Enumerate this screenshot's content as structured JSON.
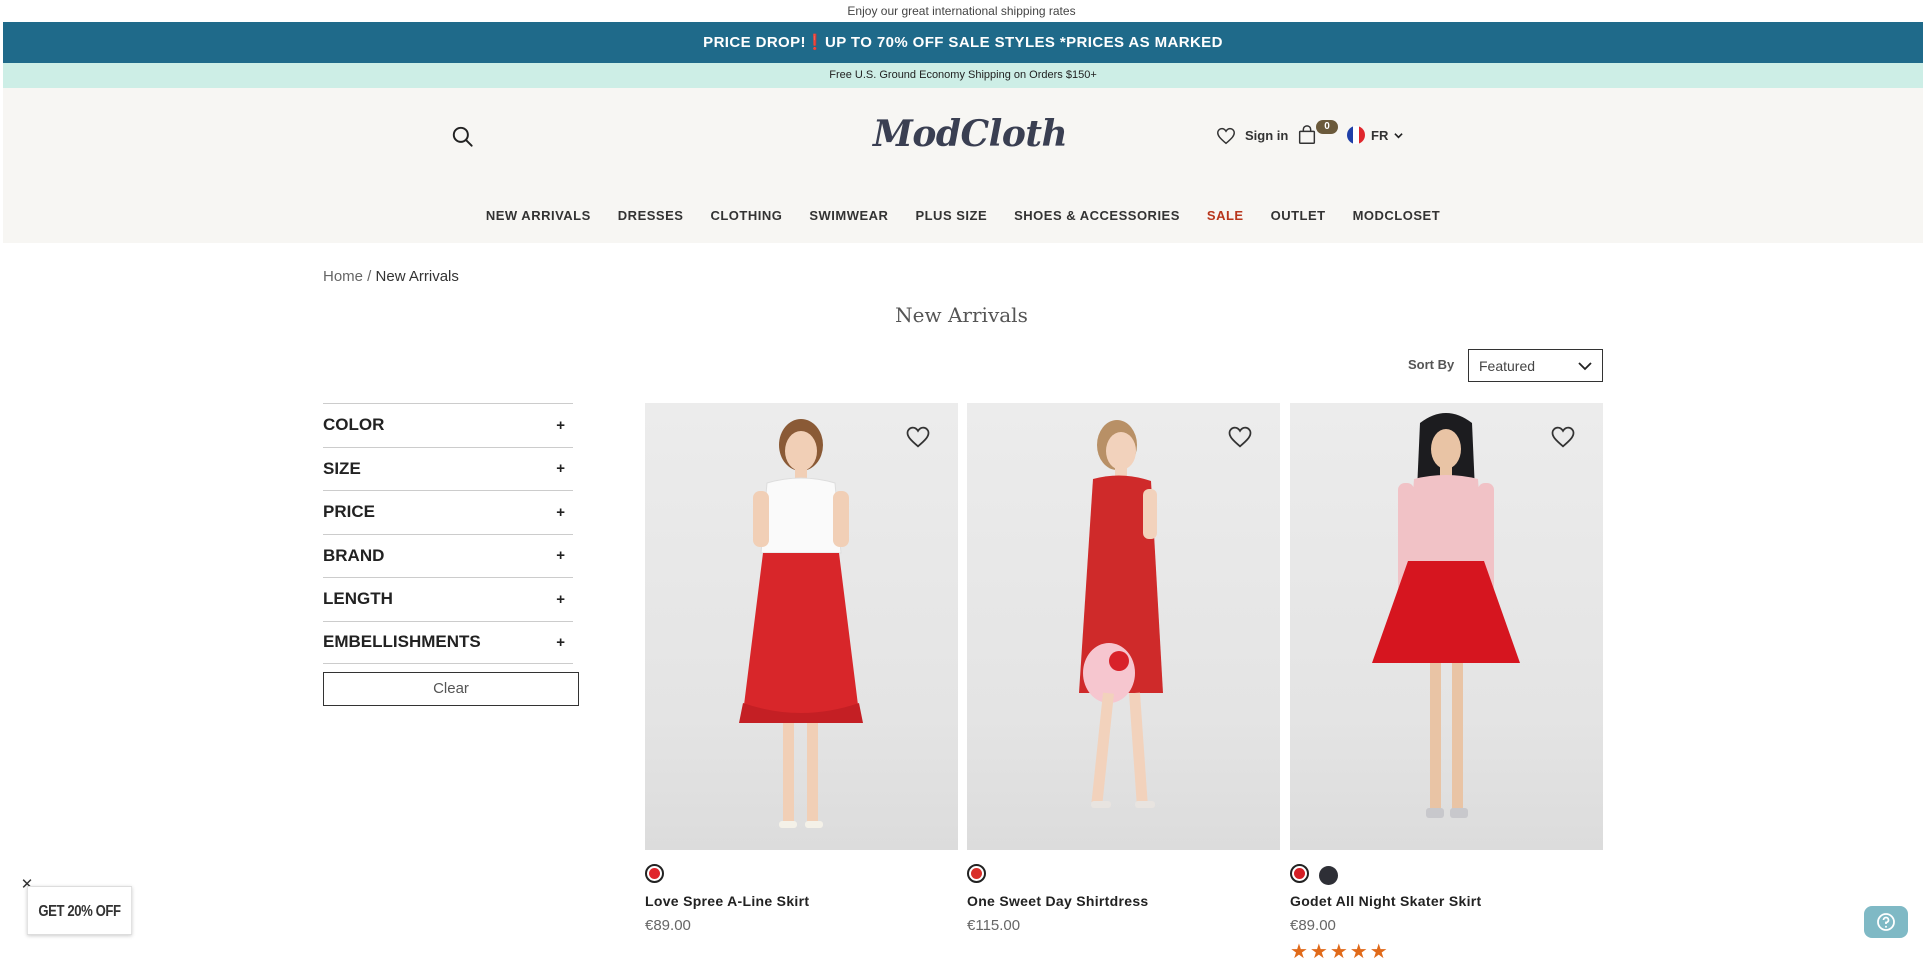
{
  "topbar": {
    "text": "Enjoy our great international shipping rates"
  },
  "promo": {
    "left": "PRICE DROP!",
    "bang": "❗",
    "right": "UP TO 70% OFF SALE STYLES *PRICES AS MARKED"
  },
  "shipping": {
    "text": "Free U.S. Ground Economy Shipping on Orders $150+"
  },
  "header": {
    "logo": "ModCloth",
    "signin": "Sign in",
    "bag_count": "0",
    "locale": "FR"
  },
  "nav": {
    "items": [
      "NEW ARRIVALS",
      "DRESSES",
      "CLOTHING",
      "SWIMWEAR",
      "PLUS SIZE",
      "SHOES & ACCESSORIES",
      "SALE",
      "OUTLET",
      "MODCLOSET"
    ]
  },
  "breadcrumb": {
    "home": "Home",
    "sep": " / ",
    "current": "New Arrivals"
  },
  "page_title": "New Arrivals",
  "sort": {
    "label": "Sort By",
    "value": "Featured"
  },
  "filters": [
    "COLOR",
    "SIZE",
    "PRICE",
    "BRAND",
    "LENGTH",
    "EMBELLISHMENTS"
  ],
  "filter_toggle": "+",
  "clear_label": "Clear",
  "products": [
    {
      "name": "Love Spree A-Line Skirt",
      "price": "€89.00",
      "swatches": [
        "#e0262c"
      ],
      "top": "#ffffff",
      "bottom": "#d8262a"
    },
    {
      "name": "One Sweet Day Shirtdress",
      "price": "€115.00",
      "swatches": [
        "#d9302a"
      ],
      "top": "#cf2a2a",
      "bottom": "#cf2a2a"
    },
    {
      "name": "Godet All Night Skater Skirt",
      "price": "€89.00",
      "swatches": [
        "#d51f26",
        "#2e2f36"
      ],
      "top": "#f1c2c6",
      "bottom": "#d6151f",
      "stars": "★★★★★"
    }
  ],
  "promo_popup": {
    "text": "GET 20% OFF",
    "close": "✕"
  },
  "colors": {
    "promo_bg": "#1f6a8a",
    "shipping_bg": "#cdeee6",
    "header_bg": "#f7f6f3",
    "sale": "#b8361c",
    "stars": "#e06a1a"
  }
}
